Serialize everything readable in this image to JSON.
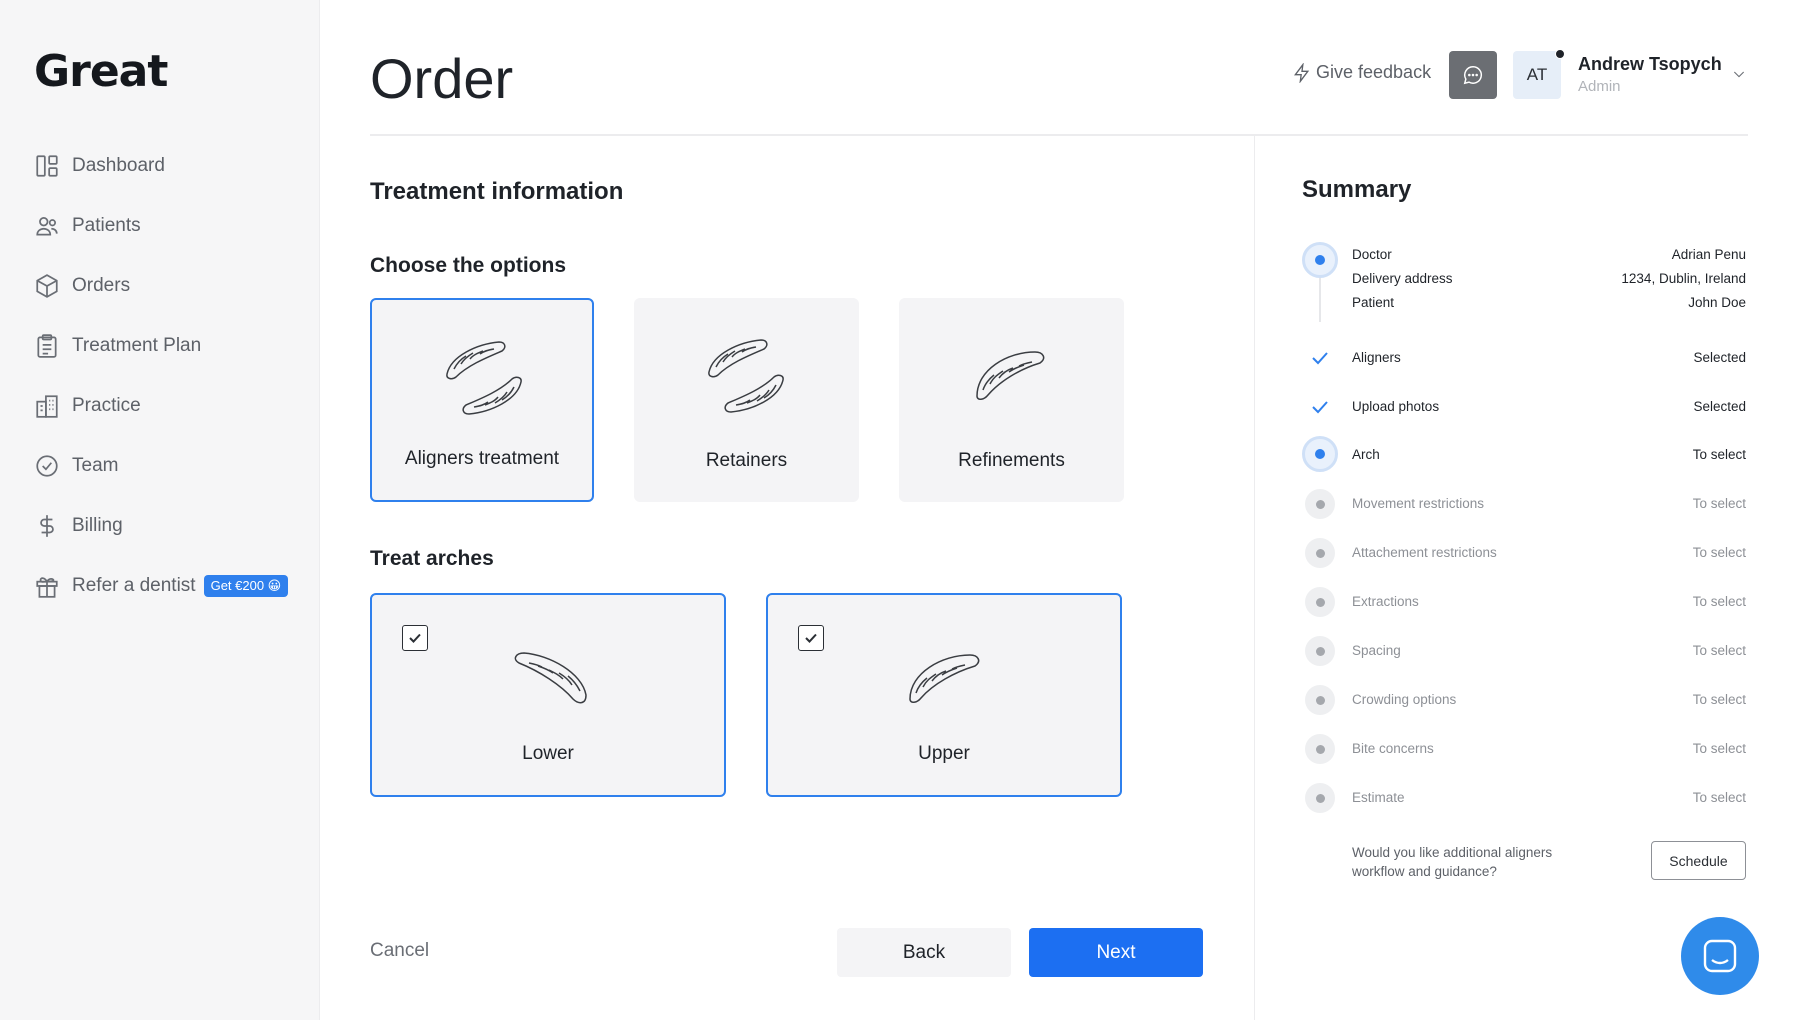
{
  "sidebar": {
    "logo": "Great",
    "items": [
      {
        "label": "Dashboard"
      },
      {
        "label": "Patients"
      },
      {
        "label": "Orders"
      },
      {
        "label": "Treatment Plan"
      },
      {
        "label": "Practice"
      },
      {
        "label": "Team"
      },
      {
        "label": "Billing"
      },
      {
        "label": "Refer a dentist",
        "badge": "Get €200 😀"
      }
    ]
  },
  "header": {
    "title": "Order",
    "feedback_label": "Give feedback",
    "user": {
      "initials": "AT",
      "name": "Andrew Tsopych",
      "role": "Admin"
    }
  },
  "main": {
    "section_title": "Treatment information",
    "options_title": "Choose the options",
    "options": [
      {
        "label": "Aligners treatment",
        "selected": true
      },
      {
        "label": "Retainers",
        "selected": false
      },
      {
        "label": "Refinements",
        "selected": false
      }
    ],
    "arches_title": "Treat arches",
    "arches": [
      {
        "label": "Lower",
        "checked": true
      },
      {
        "label": "Upper",
        "checked": true
      }
    ],
    "cancel_label": "Cancel",
    "back_label": "Back",
    "next_label": "Next"
  },
  "summary": {
    "title": "Summary",
    "info": [
      {
        "label": "Doctor",
        "value": "Adrian Penu"
      },
      {
        "label": "Delivery address",
        "value": "1234, Dublin, Ireland"
      },
      {
        "label": "Patient",
        "value": "John Doe"
      }
    ],
    "steps": [
      {
        "label": "Aligners",
        "value": "Selected",
        "state": "done"
      },
      {
        "label": "Upload photos",
        "value": "Selected",
        "state": "done"
      },
      {
        "label": "Arch",
        "value": "To select",
        "state": "current"
      },
      {
        "label": "Movement restrictions",
        "value": "To select",
        "state": "pending"
      },
      {
        "label": "Attachement restrictions",
        "value": "To select",
        "state": "pending"
      },
      {
        "label": "Extractions",
        "value": "To select",
        "state": "pending"
      },
      {
        "label": "Spacing",
        "value": "To select",
        "state": "pending"
      },
      {
        "label": "Crowding options",
        "value": "To select",
        "state": "pending"
      },
      {
        "label": "Bite concerns",
        "value": "To select",
        "state": "pending"
      },
      {
        "label": "Estimate",
        "value": "To select",
        "state": "pending"
      }
    ],
    "question": "Would you like additional aligners workflow and guidance?",
    "schedule_label": "Schedule"
  },
  "colors": {
    "accent": "#2f80ed",
    "primary_button": "#1c6ff2",
    "sidebar_bg": "#f6f6f7"
  }
}
